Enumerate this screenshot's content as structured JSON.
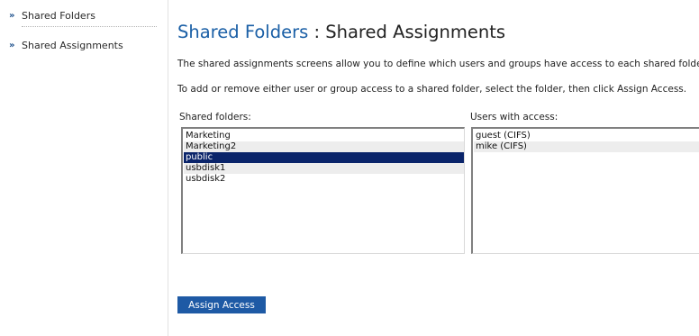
{
  "sidebar": {
    "items": [
      {
        "arrow": "»",
        "label": "Shared Folders"
      },
      {
        "arrow": "»",
        "label": "Shared Assignments"
      }
    ]
  },
  "header": {
    "title_link": "Shared Folders",
    "title_separator": " : ",
    "title_current": "Shared Assignments"
  },
  "content": {
    "description_1": "The shared assignments screens allow you to define which users and groups have access to each shared folder.",
    "description_2": "To add or remove either user or group access to a shared folder, select the folder, then click Assign Access."
  },
  "folders": {
    "label": "Shared folders:",
    "items": [
      "Marketing",
      "Marketing2",
      "public",
      "usbdisk1",
      "usbdisk2"
    ],
    "selected": "public"
  },
  "users": {
    "label": "Users with access:",
    "items": [
      "guest (CIFS)",
      "mike (CIFS)"
    ]
  },
  "actions": {
    "assign_label": "Assign Access"
  },
  "colors": {
    "accent": "#1e5aa5",
    "link": "#1a5fa6",
    "selection": "#0a246a"
  }
}
